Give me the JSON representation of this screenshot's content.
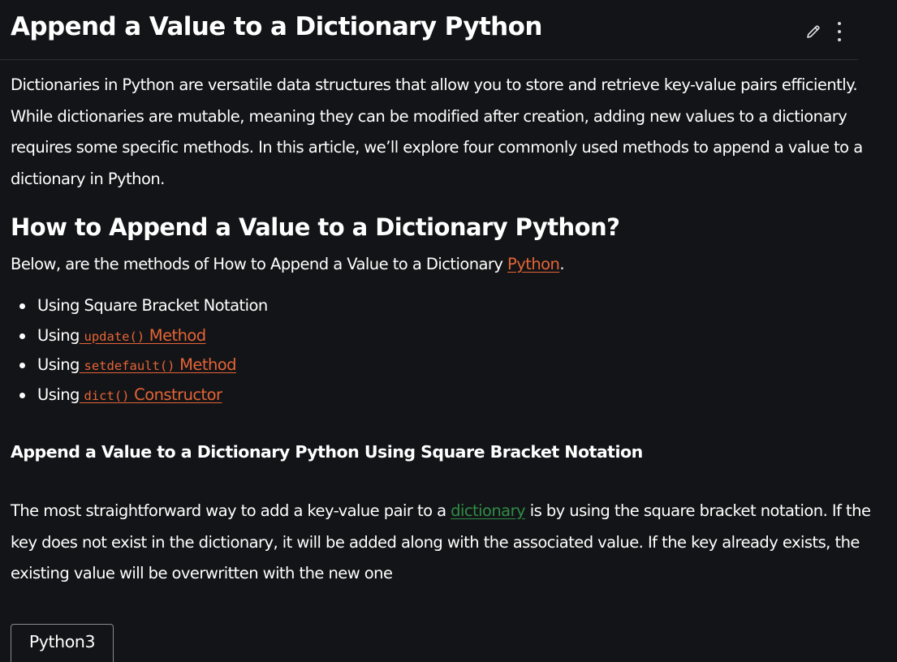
{
  "article": {
    "title": "Append a Value to a Dictionary Python",
    "intro": "Dictionaries in Python are versatile data structures that allow you to store and retrieve key-value pairs efficiently. While dictionaries are mutable, meaning they can be modified after creation, adding new values to a dictionary requires some specific methods. In this article, we’ll explore four commonly used methods to append a value to a dictionary in Python.",
    "heading": "How to Append a Value to a Dictionary Python?",
    "below_text": "Below, are the methods of How to Append a Value to a Dictionary ",
    "below_link": "Python",
    "below_end": ".",
    "methods": [
      {
        "text": "Using Square Bracket Notation"
      },
      {
        "prefix": "Using",
        "code": "update()",
        "suffix": " Method"
      },
      {
        "prefix": "Using",
        "code": "setdefault()",
        "suffix": " Method"
      },
      {
        "prefix": "Using",
        "code": "dict()",
        "suffix": " Constructor"
      }
    ],
    "subheading": "Append a Value to a Dictionary Python Using Square Bracket Notation",
    "para_before_link": "The most straightforward way to add a key-value pair to a ",
    "para_link": "dictionary",
    "para_after_link": " is by using the square bracket notation. If the key does not exist in the dictionary, it will be added along with the associated value. If the key already exists, the existing value will be overwritten with the new one",
    "code_tab": "Python3"
  },
  "icons": {
    "edit": "pencil-icon",
    "more": "vertical-dots-icon"
  },
  "colors": {
    "background": "#131417",
    "text": "#ffffff",
    "link_orange": "#e56436",
    "link_green": "#2f8d46"
  }
}
